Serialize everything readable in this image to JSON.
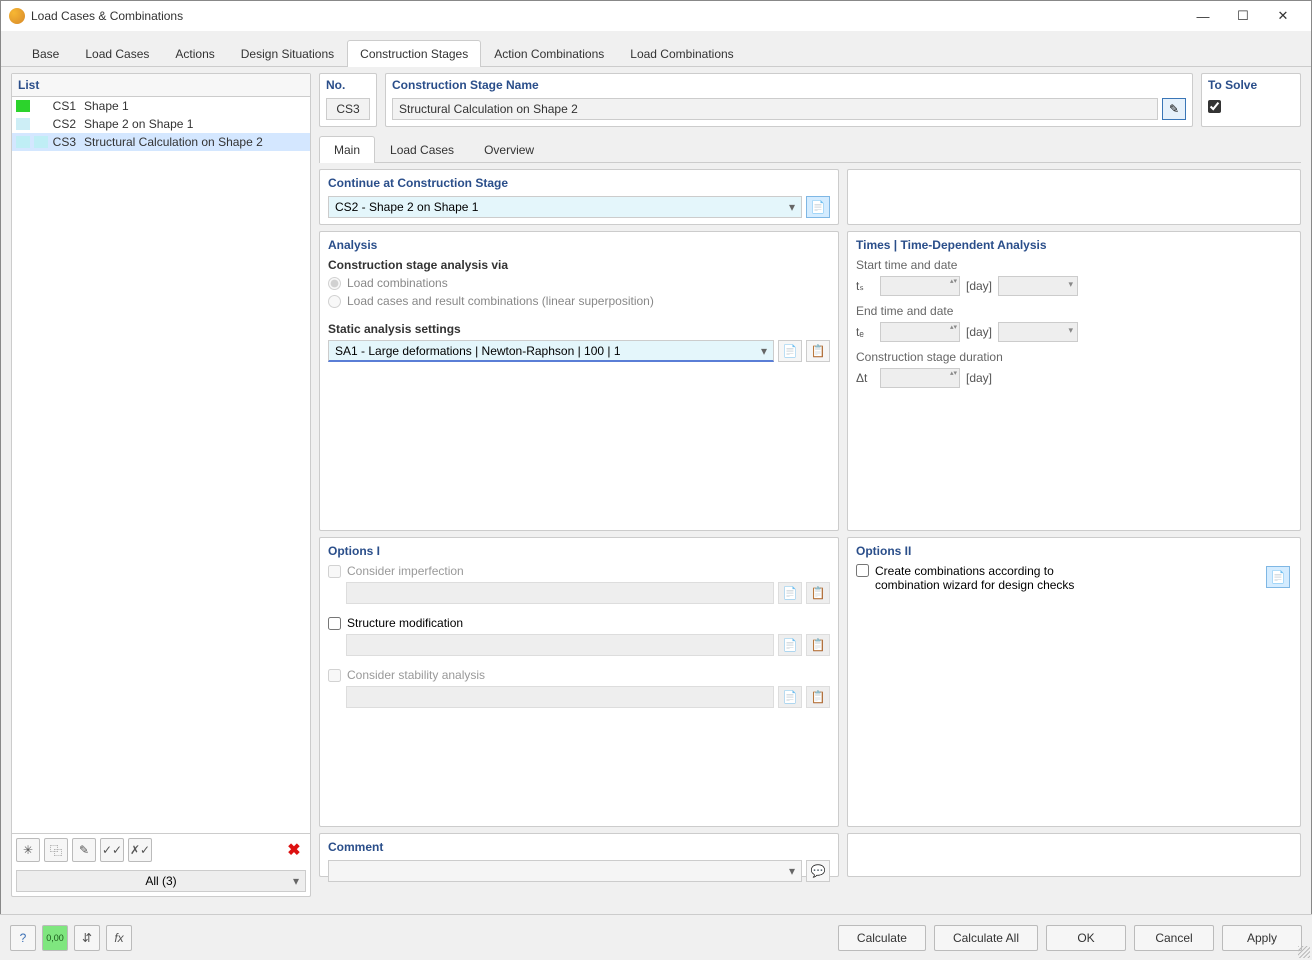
{
  "window": {
    "title": "Load Cases & Combinations"
  },
  "main_tabs": [
    "Base",
    "Load Cases",
    "Actions",
    "Design Situations",
    "Construction Stages",
    "Action Combinations",
    "Load Combinations"
  ],
  "main_tab_active": 4,
  "list": {
    "header": "List",
    "items": [
      {
        "id": "CS1",
        "label": "Shape 1",
        "color": "#2cd32c"
      },
      {
        "id": "CS2",
        "label": "Shape 2 on Shape 1",
        "color": "#cdeef6"
      },
      {
        "id": "CS3",
        "label": "Structural Calculation on Shape 2",
        "color": "#bfeef5"
      }
    ],
    "selected": 2,
    "filter": "All (3)"
  },
  "header": {
    "no_label": "No.",
    "no_value": "CS3",
    "name_label": "Construction Stage Name",
    "name_value": "Structural Calculation on Shape 2",
    "solve_label": "To Solve",
    "solve_checked": true
  },
  "sub_tabs": [
    "Main",
    "Load Cases",
    "Overview"
  ],
  "sub_tab_active": 0,
  "continue": {
    "header": "Continue at Construction Stage",
    "value": "CS2 - Shape 2 on Shape 1"
  },
  "analysis": {
    "header": "Analysis",
    "via_label": "Construction stage analysis via",
    "radio1": "Load combinations",
    "radio2": "Load cases and result combinations (linear superposition)",
    "settings_label": "Static analysis settings",
    "settings_value": "SA1 - Large deformations | Newton-Raphson | 100 | 1"
  },
  "times": {
    "header": "Times | Time-Dependent Analysis",
    "start_label": "Start time and date",
    "end_label": "End time and date",
    "duration_label": "Construction stage duration",
    "t_s": "tₛ",
    "t_e": "tₑ",
    "dt": "Δt",
    "unit": "[day]"
  },
  "options1": {
    "header": "Options I",
    "imperfection": "Consider imperfection",
    "structure": "Structure modification",
    "stability": "Consider stability analysis"
  },
  "options2": {
    "header": "Options II",
    "combinations": "Create combinations according to combination wizard for design checks"
  },
  "comment": {
    "header": "Comment"
  },
  "buttons": {
    "calculate": "Calculate",
    "calculate_all": "Calculate All",
    "ok": "OK",
    "cancel": "Cancel",
    "apply": "Apply"
  }
}
